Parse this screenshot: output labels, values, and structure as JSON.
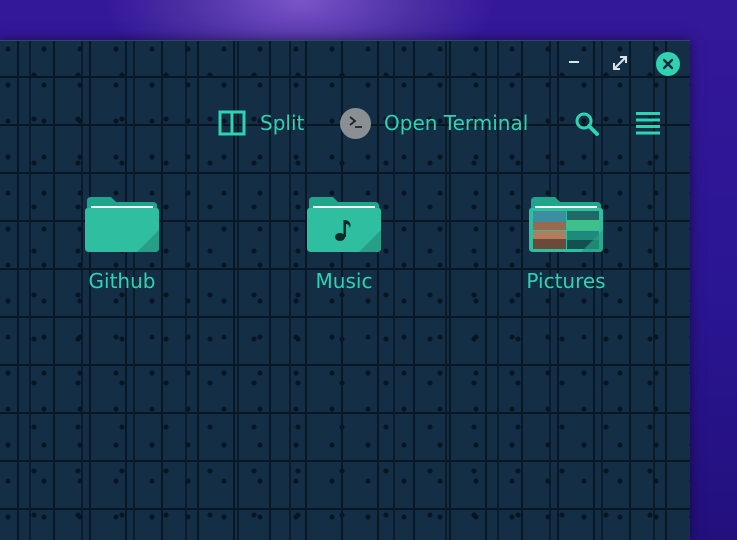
{
  "window": {
    "controls": {
      "minimize": "minimize-icon",
      "maximize": "maximize-icon",
      "close": "close-icon"
    }
  },
  "toolbar": {
    "split_label": "Split",
    "open_terminal_label": "Open Terminal",
    "search_icon": "search-icon",
    "menu_icon": "hamburger-menu-icon"
  },
  "files": [
    {
      "name": "Github",
      "icon": "folder-icon"
    },
    {
      "name": "Music",
      "icon": "music-folder-icon"
    },
    {
      "name": "Pictures",
      "icon": "pictures-folder-icon"
    }
  ],
  "colors": {
    "accent": "#2fd3b2",
    "window_bg": "#142e45",
    "desktop_bg": "#2a1592"
  }
}
